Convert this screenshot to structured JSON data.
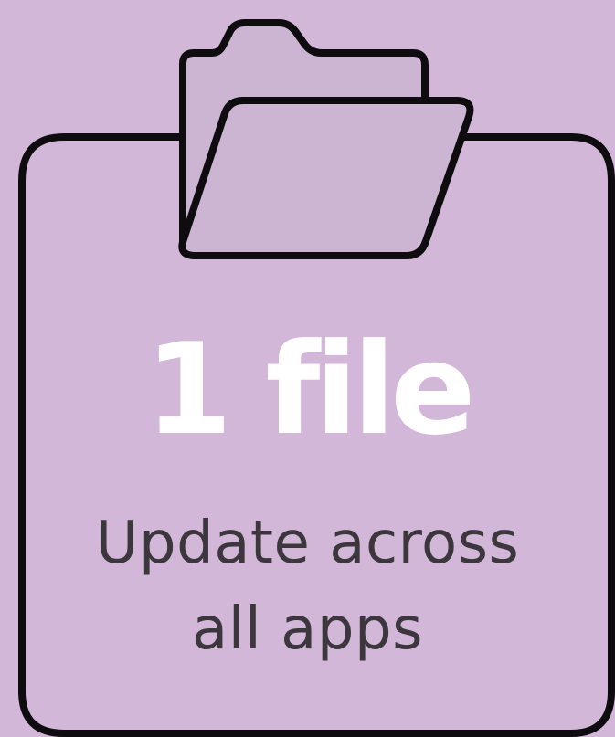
{
  "headline": "1 file",
  "subline": {
    "line1": "Update across",
    "line2": "all apps"
  },
  "icon": "folder-open-icon",
  "colors": {
    "background": "#d3b7d9",
    "folder_fill": "#cbb5d3",
    "outline": "#0e0c0f",
    "headline": "#ffffff",
    "subline": "#3b373d"
  }
}
